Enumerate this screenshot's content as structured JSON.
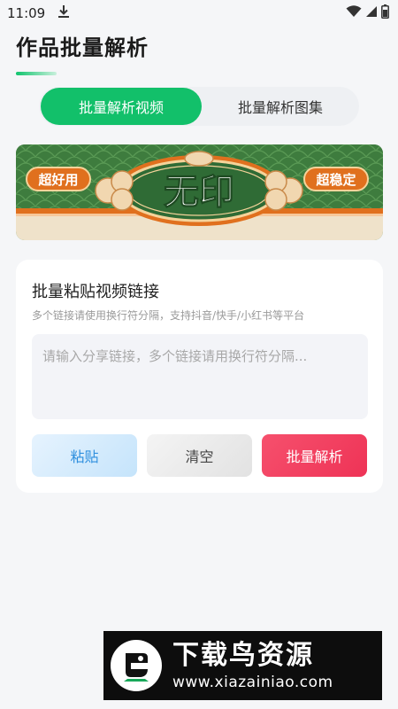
{
  "status_bar": {
    "time": "11:09",
    "icons": [
      "download-icon",
      "wifi-icon",
      "signal-icon",
      "battery-icon"
    ]
  },
  "header": {
    "title": "作品批量解析"
  },
  "tabs": [
    {
      "label": "批量解析视频",
      "active": true
    },
    {
      "label": "批量解析图集",
      "active": false
    }
  ],
  "banner": {
    "left_badge": "超好用",
    "center_text": "无印",
    "right_badge": "超稳定"
  },
  "card": {
    "title": "批量粘贴视频链接",
    "subtitle": "多个链接请使用换行符分隔，支持抖音/快手/小红书等平台",
    "input_placeholder": "请输入分享链接，多个链接请用换行符分隔...",
    "input_value": "",
    "paste_label": "粘贴",
    "clear_label": "清空",
    "parse_label": "批量解析"
  },
  "watermark": {
    "name": "下载鸟资源",
    "url": "www.xiazainiao.com"
  },
  "colors": {
    "accent_green": "#12c06a",
    "parse_red": "#f04060",
    "paste_blue": "#2e8fde",
    "banner_green": "#3e7c3e",
    "banner_orange": "#e0701e"
  }
}
